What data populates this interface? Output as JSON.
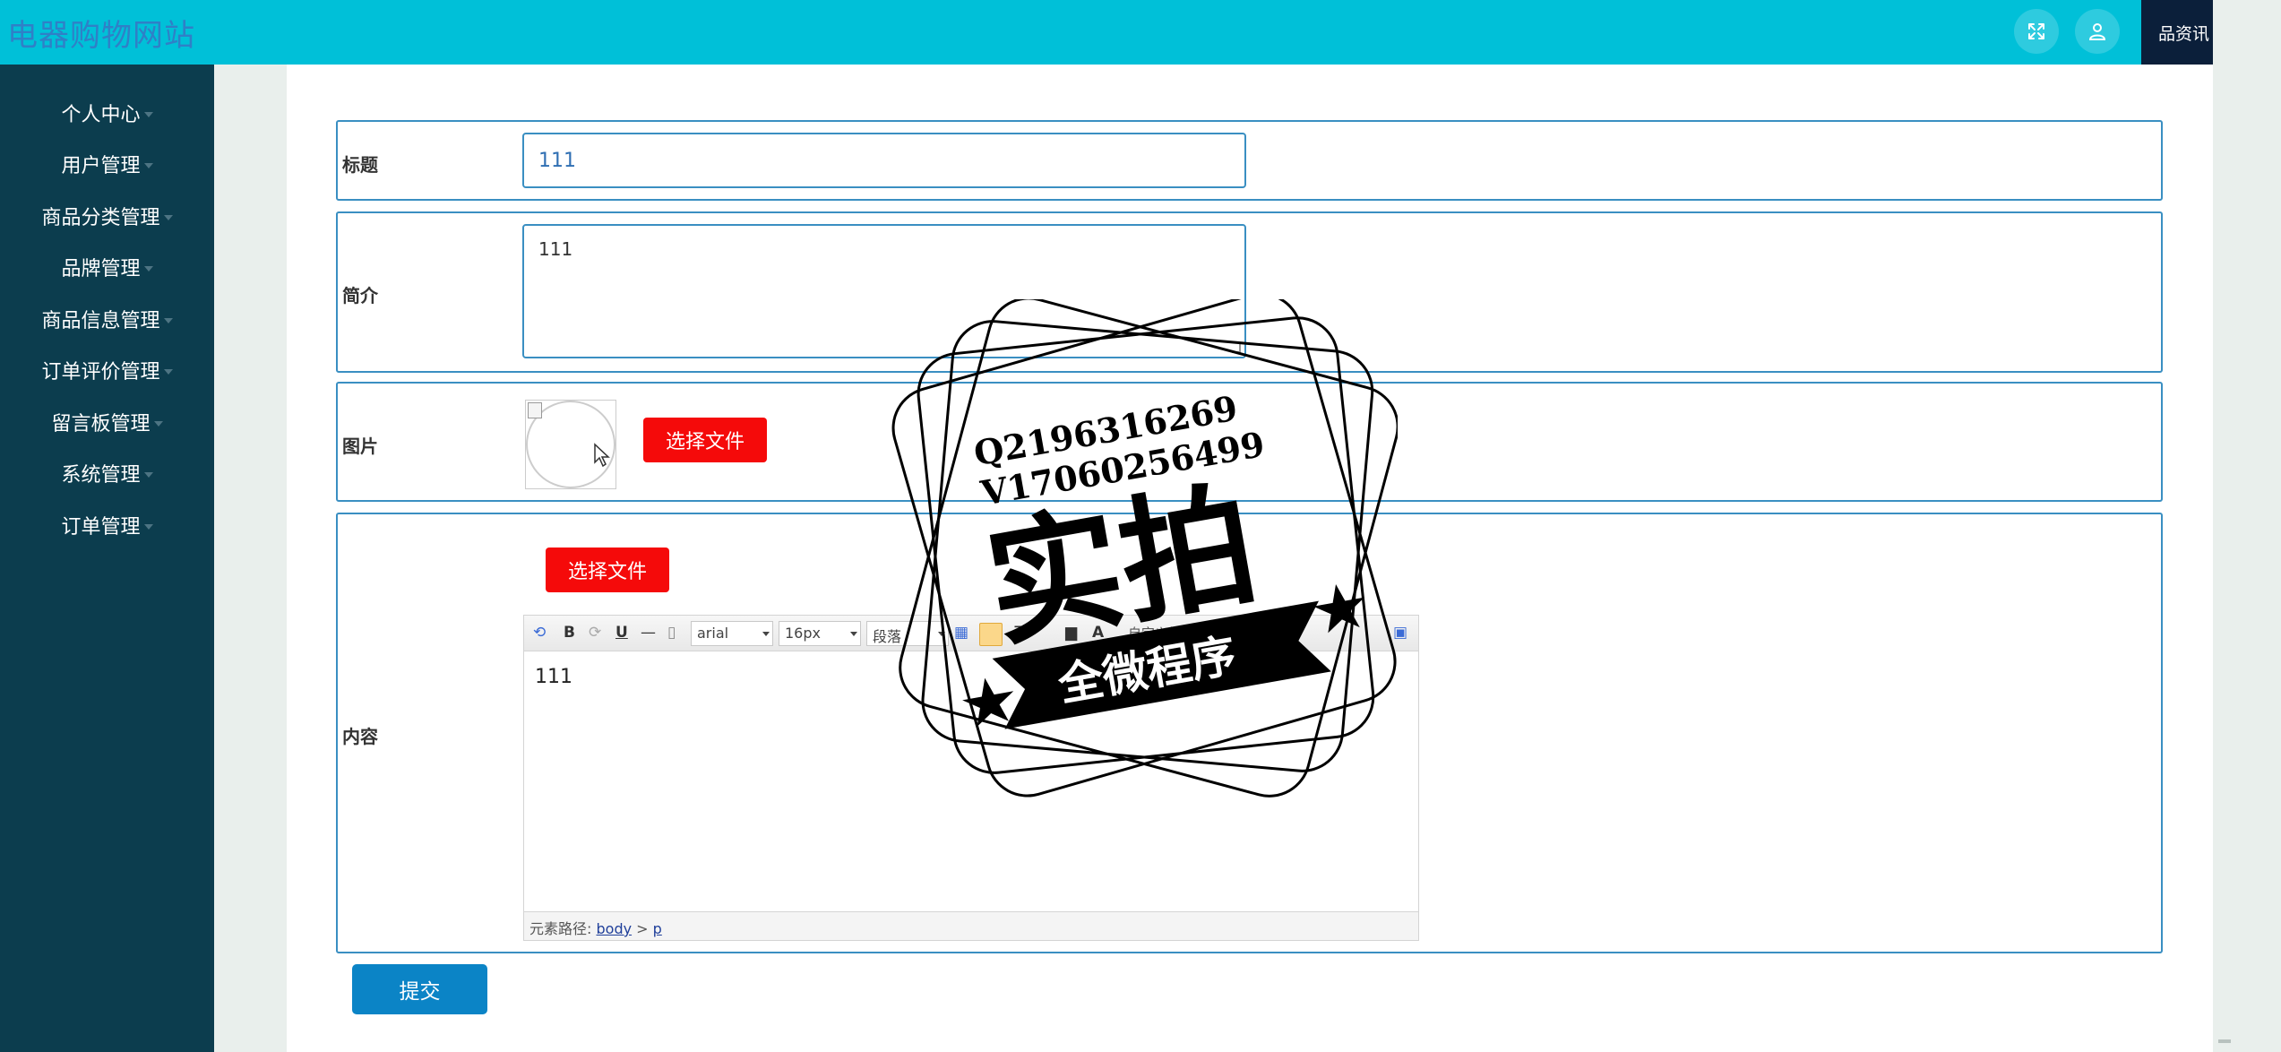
{
  "app": {
    "title": "电器购物网站",
    "header_menu_label": "品资讯"
  },
  "icons": {
    "fullscreen": "fullscreen-icon",
    "user": "user-icon"
  },
  "sidebar": {
    "items": [
      {
        "label": "个人中心"
      },
      {
        "label": "用户管理"
      },
      {
        "label": "商品分类管理"
      },
      {
        "label": "品牌管理"
      },
      {
        "label": "商品信息管理"
      },
      {
        "label": "订单评价管理"
      },
      {
        "label": "留言板管理"
      },
      {
        "label": "系统管理"
      },
      {
        "label": "订单管理"
      }
    ]
  },
  "form": {
    "title_label": "标题",
    "title_value": "111",
    "intro_label": "简介",
    "intro_value": "111",
    "image_label": "图片",
    "image_choose_button": "选择文件",
    "content_label": "内容",
    "content_choose_button": "选择文件",
    "submit_button": "提交"
  },
  "editor": {
    "font_family": "arial",
    "font_size": "16px",
    "paragraph": "段落",
    "custom_title": "自定义标题",
    "content": "111",
    "path_label": "元素路径:",
    "path_body": "body",
    "path_sep": ">",
    "path_p": "p"
  },
  "watermark": {
    "line1": "Q2196316269",
    "line2": "V17060256499",
    "main": "实拍",
    "ribbon": "全微程序"
  },
  "colors": {
    "header": "#00c0d8",
    "sidebar": "#0c3d4e",
    "accent_red": "#f50a0a",
    "submit_blue": "#0b84c6",
    "border_blue": "#3a8fc2"
  }
}
